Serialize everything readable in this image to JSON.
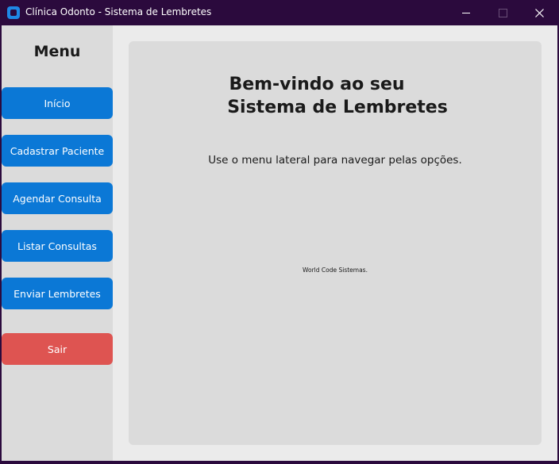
{
  "window": {
    "title": "Clínica Odonto - Sistema de Lembretes",
    "icon": "app-icon",
    "controls": [
      "minimize-icon",
      "maximize-icon",
      "close-icon"
    ]
  },
  "sidebar": {
    "title": "Menu",
    "items": [
      {
        "label": "Início"
      },
      {
        "label": "Cadastrar Paciente"
      },
      {
        "label": "Agendar Consulta"
      },
      {
        "label": "Listar Consultas"
      },
      {
        "label": "Enviar Lembretes"
      }
    ],
    "exit_label": "Sair"
  },
  "main": {
    "welcome_line1": "Bem-vindo ao seu",
    "welcome_line2": "Sistema de Lembretes",
    "instruction": "Use o menu lateral para navegar pelas opções.",
    "credit": "World Code Sistemas."
  },
  "colors": {
    "titlebar": "#2b0a3d",
    "primary_button": "#0b78d6",
    "danger_button": "#de5451",
    "panel": "#dbdbdb",
    "background": "#ebebeb"
  }
}
